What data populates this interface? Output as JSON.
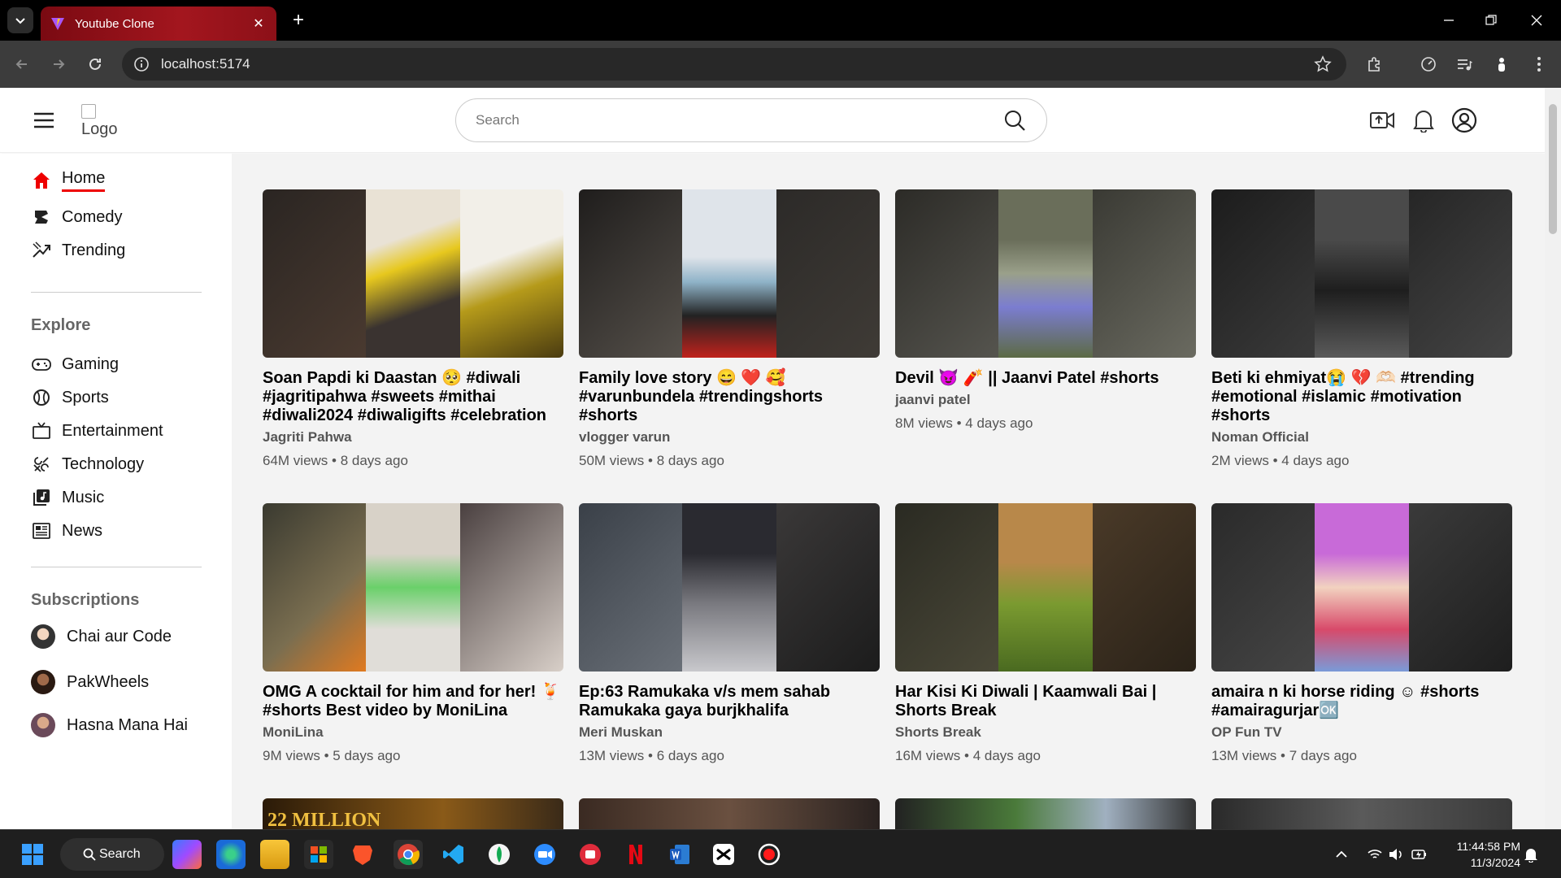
{
  "browser": {
    "tab_title": "Youtube Clone",
    "url": "localhost:5174"
  },
  "header": {
    "logo_alt": "Logo",
    "search_placeholder": "Search"
  },
  "sidebar": {
    "items": [
      {
        "label": "Home",
        "icon": "home-icon",
        "active": true
      },
      {
        "label": "Comedy",
        "icon": "comedy-icon"
      },
      {
        "label": "Trending",
        "icon": "trending-icon"
      }
    ],
    "explore_heading": "Explore",
    "explore": [
      {
        "label": "Gaming",
        "icon": "gamepad-icon"
      },
      {
        "label": "Sports",
        "icon": "sports-icon"
      },
      {
        "label": "Entertainment",
        "icon": "tv-icon"
      },
      {
        "label": "Technology",
        "icon": "technology-icon"
      },
      {
        "label": "Music",
        "icon": "music-icon"
      },
      {
        "label": "News",
        "icon": "news-icon"
      }
    ],
    "subscriptions_heading": "Subscriptions",
    "subscriptions": [
      {
        "name": "Chai aur Code"
      },
      {
        "name": "PakWheels"
      },
      {
        "name": "Hasna Mana Hai"
      }
    ]
  },
  "videos": [
    {
      "title": "Soan Papdi ki Daastan 🥺 #diwali #jagritipahwa #sweets #mithai #diwali2024 #diwaligifts #celebration",
      "channel": "Jagriti Pahwa",
      "views": "64M views",
      "age": "8 days ago"
    },
    {
      "title": "Family love story 😄 ❤️ 🥰 #varunbundela #trendingshorts #shorts",
      "channel": "vlogger varun",
      "views": "50M views",
      "age": "8 days ago"
    },
    {
      "title": "Devil 😈 🧨 || Jaanvi Patel #shorts",
      "channel": "jaanvi patel",
      "views": "8M views",
      "age": "4 days ago"
    },
    {
      "title": "Beti ki ehmiyat😭 💔 🫶🏻 #trending #emotional #islamic #motivation #shorts",
      "channel": "Noman Official",
      "views": "2M views",
      "age": "4 days ago"
    },
    {
      "title": "OMG A cocktail for him and for her! 🍹 #shorts Best video by MoniLina",
      "channel": "MoniLina",
      "views": "9M views",
      "age": "5 days ago"
    },
    {
      "title": "Ep:63 Ramukaka v/s mem sahab Ramukaka gaya burjkhalifa",
      "channel": "Meri Muskan",
      "views": "13M views",
      "age": "6 days ago"
    },
    {
      "title": "Har Kisi Ki Diwali | Kaamwali Bai | Shorts Break",
      "channel": "Shorts Break",
      "views": "16M views",
      "age": "4 days ago"
    },
    {
      "title": "amaira n ki horse riding ☺ #shorts #amairagurjar🆗",
      "channel": "OP Fun TV",
      "views": "13M views",
      "age": "7 days ago"
    }
  ],
  "partial_thumb_text": "22 MILLION",
  "taskbar": {
    "search_label": "Search",
    "time": "11:44:58 PM",
    "date": "11/3/2024"
  },
  "colors": {
    "accent": "#e00000",
    "tab_red": "#a3161e",
    "main_bg": "#f3f3f3"
  }
}
